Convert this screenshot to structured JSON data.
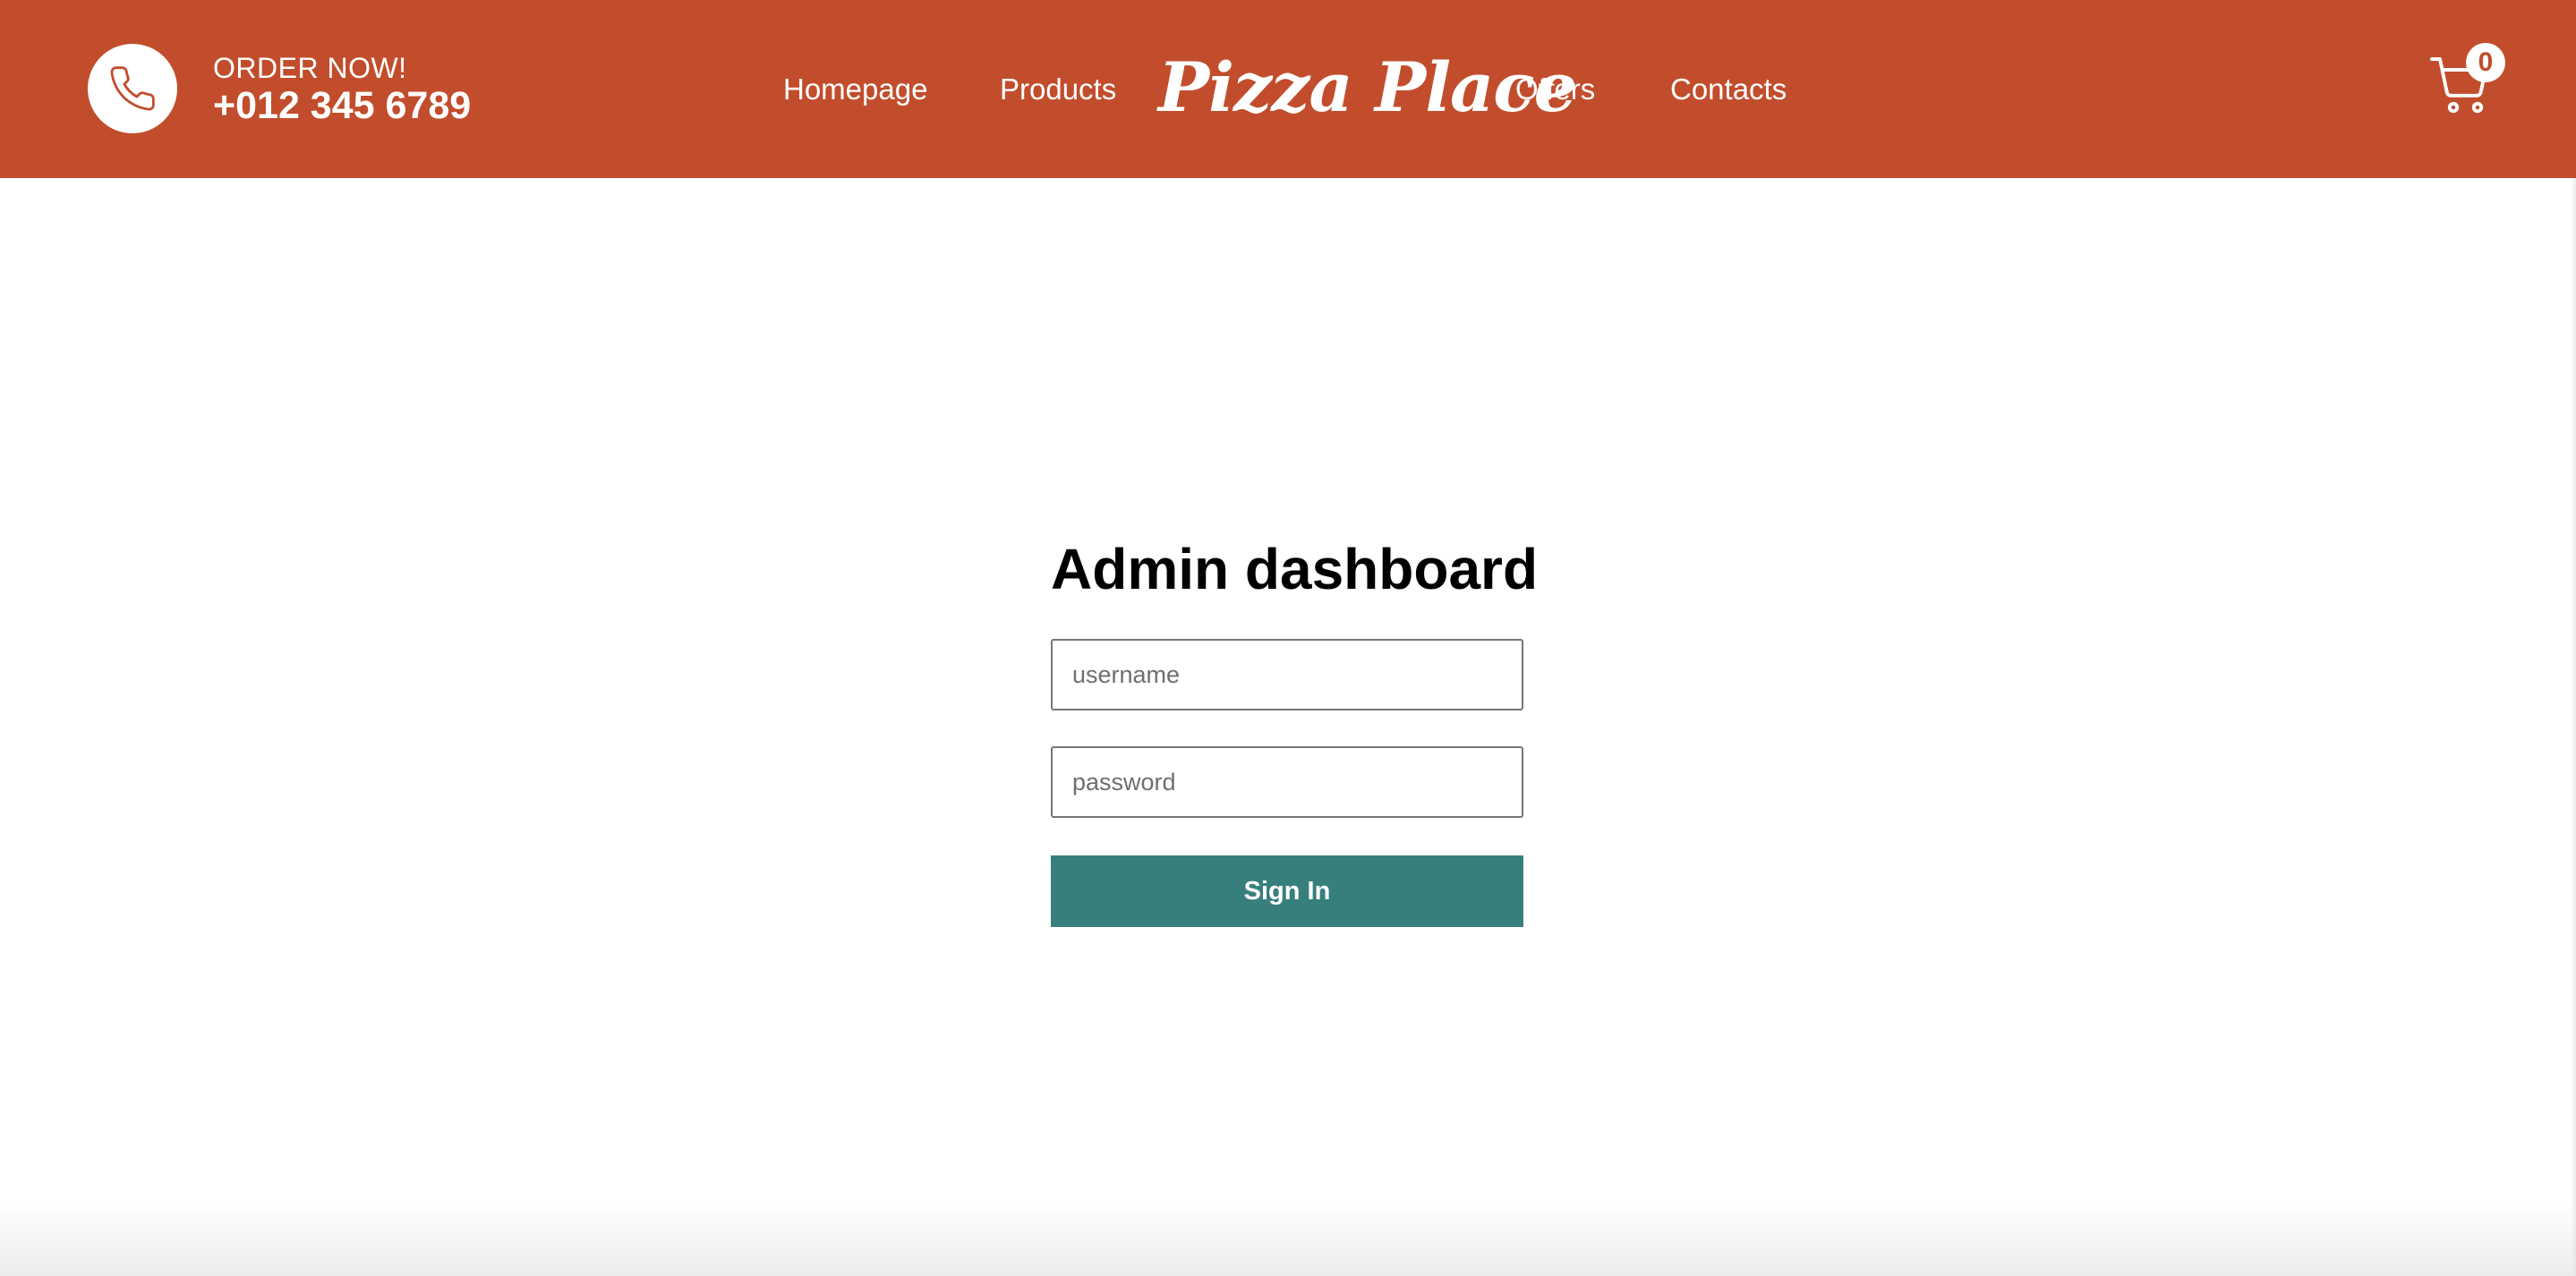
{
  "header": {
    "order_label": "ORDER NOW!",
    "phone": "+012 345 6789",
    "logo": "Pizza Place",
    "nav": {
      "homepage": "Homepage",
      "products": "Products",
      "offers": "Offers",
      "contacts": "Contacts"
    },
    "cart_count": "0",
    "icons": {
      "phone": "phone-icon",
      "cart": "cart-icon"
    }
  },
  "login": {
    "title": "Admin dashboard",
    "username_placeholder": "username",
    "password_placeholder": "password",
    "signin_label": "Sign In"
  },
  "colors": {
    "brand": "#c24d2c",
    "button": "#377f7d"
  }
}
